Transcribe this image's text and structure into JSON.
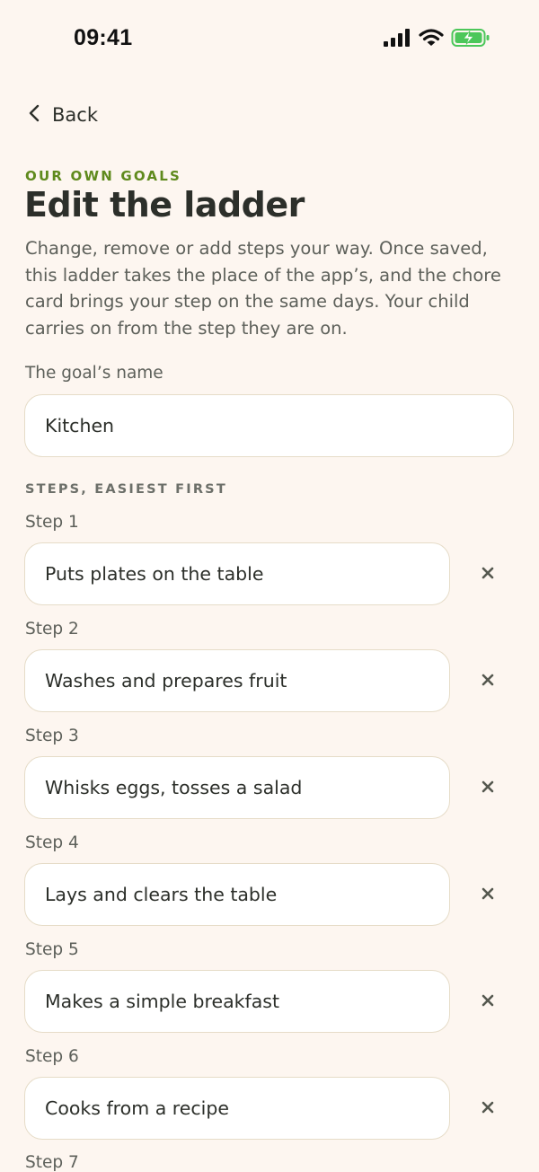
{
  "status_bar": {
    "time": "09:41",
    "battery_color": "#4cc75a"
  },
  "nav": {
    "back_label": "Back"
  },
  "header": {
    "eyebrow": "OUR OWN GOALS",
    "title": "Edit the ladder",
    "description": "Change, remove or add steps your way. Once saved, this ladder takes the place of the app’s, and the chore card brings your step on the same days. Your child carries on from the step they are on."
  },
  "goal": {
    "label": "The goal’s name",
    "value": "Kitchen"
  },
  "steps_section": {
    "label": "STEPS, EASIEST FIRST",
    "steps": [
      {
        "label": "Step 1",
        "value": "Puts plates on the table"
      },
      {
        "label": "Step 2",
        "value": "Washes and prepares fruit"
      },
      {
        "label": "Step 3",
        "value": "Whisks eggs, tosses a salad"
      },
      {
        "label": "Step 4",
        "value": "Lays and clears the table"
      },
      {
        "label": "Step 5",
        "value": "Makes a simple breakfast"
      },
      {
        "label": "Step 6",
        "value": "Cooks from a recipe"
      },
      {
        "label": "Step 7",
        "value": ""
      }
    ]
  },
  "colors": {
    "background": "#fdf6f0",
    "accent": "#5f8a1d",
    "input_border": "#e6dcc8"
  }
}
